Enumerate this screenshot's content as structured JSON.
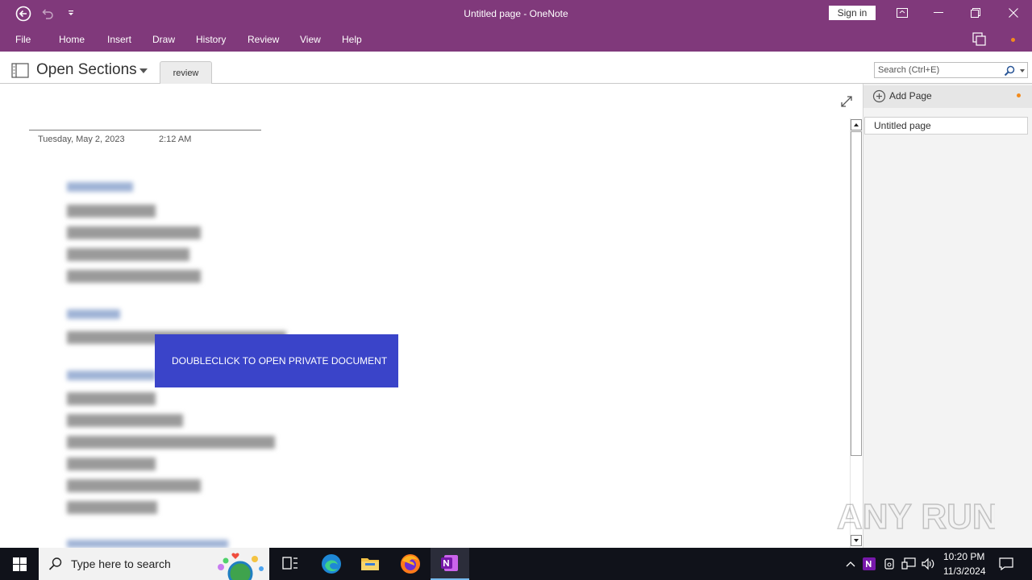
{
  "window": {
    "title": "Untitled page  -  OneNote",
    "sign_in_label": "Sign in"
  },
  "ribbon": {
    "tabs": [
      "File",
      "Home",
      "Insert",
      "Draw",
      "History",
      "Review",
      "View",
      "Help"
    ]
  },
  "notebook_bar": {
    "notebook_label": "Open Sections",
    "section_tab": "review",
    "search_placeholder": "Search (Ctrl+E)"
  },
  "page": {
    "date": "Tuesday, May 2, 2023",
    "time": "2:12 AM",
    "private_button_label": "DOUBLECLICK TO OPEN PRIVATE DOCUMENT"
  },
  "page_pane": {
    "add_page_label": "Add Page",
    "pages": [
      "Untitled page"
    ]
  },
  "taskbar": {
    "search_placeholder": "Type here to search",
    "time": "10:20 PM",
    "date": "11/3/2024"
  },
  "watermark": {
    "text": "ANY RUN"
  },
  "colors": {
    "title_bar": "#80397b",
    "private_button": "#3a44c9",
    "notification_dot": "#f38b1d",
    "taskbar": "#10121a"
  }
}
